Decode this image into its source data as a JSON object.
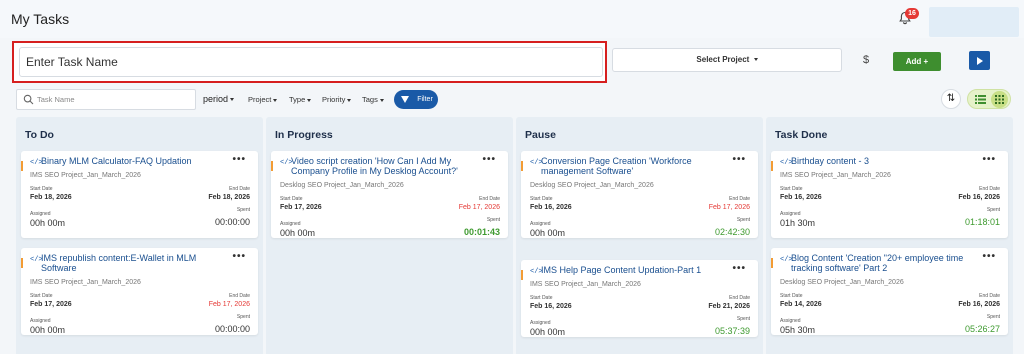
{
  "header": {
    "title": "My Tasks",
    "notifications_count": "16"
  },
  "toolbar": {
    "task_name_placeholder": "Enter Task Name",
    "project_select": "Select Project",
    "currency": "$",
    "add_label": "Add +"
  },
  "filters": {
    "search_placeholder": "Task Name",
    "period": "period",
    "project": "Project",
    "type": "Type",
    "priority": "Priority",
    "tags": "Tags",
    "filter_label": "Filter"
  },
  "labels": {
    "start_date": "Start Date",
    "end_date": "End Date",
    "assigned": "Assigned",
    "spent": "Spent"
  },
  "colors": {
    "accent_blue": "#1a5aa7",
    "add_green": "#3e8e2f",
    "overdue_red": "#e53935",
    "spent_green": "#3e9a2f",
    "highlight_border": "#d61f1f"
  },
  "columns": [
    {
      "title": "To Do",
      "cards": [
        {
          "title": "Binary MLM Calculator-FAQ Updation",
          "project": "IMS SEO Project_Jan_March_2026",
          "start": "Feb 18, 2026",
          "end": "Feb 18, 2026",
          "end_overdue": false,
          "assigned": "00h 00m",
          "spent": "00:00:00",
          "spent_green": false
        },
        {
          "title": "IMS republish content:E-Wallet in MLM Software",
          "project": "IMS SEO Project_Jan_March_2026",
          "start": "Feb 17, 2026",
          "end": "Feb 17, 2026",
          "end_overdue": true,
          "assigned": "00h 00m",
          "spent": "00:00:00",
          "spent_green": false
        }
      ]
    },
    {
      "title": "In Progress",
      "cards": [
        {
          "title": "Video script creation 'How Can I Add My Company Profile in My Desklog Account?'",
          "project": "Desklog SEO Project_Jan_March_2026",
          "start": "Feb 17, 2026",
          "end": "Feb 17, 2026",
          "end_overdue": true,
          "assigned": "00h 00m",
          "spent": "00:01:43",
          "spent_green": true
        }
      ]
    },
    {
      "title": "Pause",
      "cards": [
        {
          "title": "Conversion Page Creation 'Workforce management Software'",
          "project": "Desklog SEO Project_Jan_March_2026",
          "start": "Feb 16, 2026",
          "end": "Feb 17, 2026",
          "end_overdue": true,
          "assigned": "00h 00m",
          "spent": "02:42:30",
          "spent_green": true
        },
        {
          "title": "IMS Help Page Content Updation-Part 1",
          "project": "IMS SEO Project_Jan_March_2026",
          "start": "Feb 16, 2026",
          "end": "Feb 21, 2026",
          "end_overdue": false,
          "assigned": "00h 00m",
          "spent": "05:37:39",
          "spent_green": true
        }
      ]
    },
    {
      "title": "Task Done",
      "cards": [
        {
          "title": "Birthday content - 3",
          "project": "IMS SEO Project_Jan_March_2026",
          "start": "Feb 16, 2026",
          "end": "Feb 16, 2026",
          "end_overdue": false,
          "assigned": "01h 30m",
          "spent": "01:18:01",
          "spent_green": true
        },
        {
          "title": "Blog Content 'Creation \"20+ employee time tracking software' Part 2",
          "project": "Desklog SEO Project_Jan_March_2026",
          "start": "Feb 14, 2026",
          "end": "Feb 16, 2026",
          "end_overdue": false,
          "assigned": "05h 30m",
          "spent": "05:26:27",
          "spent_green": true
        }
      ]
    }
  ]
}
